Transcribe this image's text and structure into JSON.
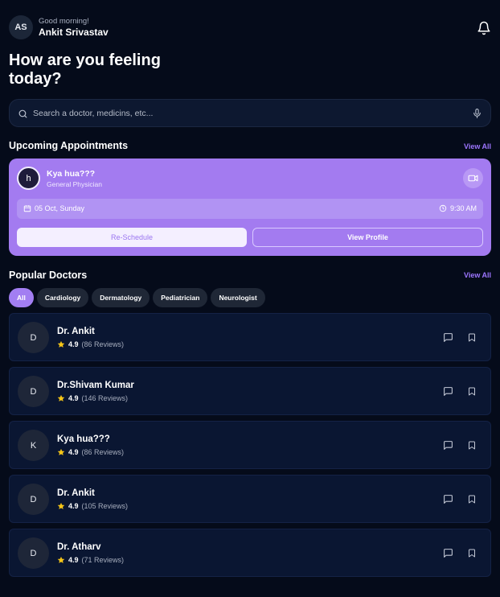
{
  "header": {
    "avatar_initials": "AS",
    "greeting": "Good morning!",
    "user_name": "Ankit Srivastav",
    "notification_icon": "bell-icon"
  },
  "headline": {
    "line1": "How are you feeling",
    "line2": "today?"
  },
  "search": {
    "placeholder": "Search a doctor, medicins, etc...",
    "value": "",
    "search_icon": "search-icon",
    "mic_icon": "microphone-icon"
  },
  "appointments": {
    "title": "Upcoming Appointments",
    "view_all": "View All",
    "card": {
      "avatar_initial": "h",
      "doctor_name": "Kya hua???",
      "specialty": "General Physician",
      "video_icon": "video-call-icon",
      "date": "05 Oct, Sunday",
      "time": "9:30 AM",
      "reschedule_label": "Re-Schedule",
      "view_profile_label": "View Profile"
    }
  },
  "popular": {
    "title": "Popular Doctors",
    "view_all": "View All",
    "filters": [
      "All",
      "Cardiology",
      "Dermatology",
      "Pediatrician",
      "Neurologist"
    ],
    "active_filter": "All",
    "doctors": [
      {
        "initial": "D",
        "name": "Dr. Ankit",
        "rating": "4.9",
        "reviews": "(86 Reviews)"
      },
      {
        "initial": "D",
        "name": "Dr.Shivam Kumar",
        "rating": "4.9",
        "reviews": "(146 Reviews)"
      },
      {
        "initial": "K",
        "name": "Kya hua???",
        "rating": "4.9",
        "reviews": "(86 Reviews)"
      },
      {
        "initial": "D",
        "name": "Dr. Ankit",
        "rating": "4.9",
        "reviews": "(105 Reviews)"
      },
      {
        "initial": "D",
        "name": "Dr. Atharv",
        "rating": "4.9",
        "reviews": "(71 Reviews)"
      }
    ]
  },
  "colors": {
    "background": "#050b1a",
    "accent": "#a37bf0",
    "card": "#0a1632",
    "star": "#f5c518",
    "link": "#9d76ff"
  }
}
